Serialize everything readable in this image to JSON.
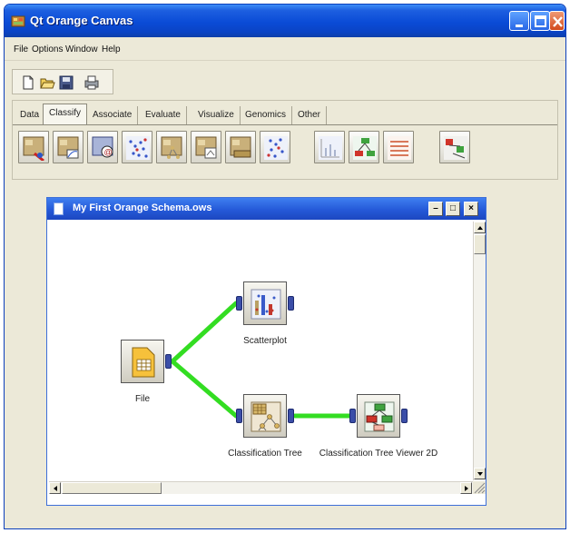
{
  "window": {
    "title": "Qt Orange Canvas"
  },
  "menu": [
    "File",
    "Options",
    "Window",
    "Help"
  ],
  "toolbar": [
    "new-document-icon",
    "open-folder-icon",
    "save-disk-icon",
    "print-icon"
  ],
  "tabs": [
    "Data",
    "Classify",
    "Associate",
    "Evaluate",
    "Visualize",
    "Genomics",
    "Other"
  ],
  "active_tab": "Classify",
  "widgets": [
    "naive-bayes-widget-icon",
    "logistic-regression-widget-icon",
    "majority-widget-icon",
    "knn-widget-icon",
    "classification-tree-widget-icon",
    "c45-widget-icon",
    "interactive-tree-widget-icon",
    "cn2-widget-icon",
    "svm-widget-icon",
    "tree-viewer-widget-icon",
    "rules-viewer-widget-icon",
    "nomogram-widget-icon"
  ],
  "document": {
    "title": "My First Orange Schema.ows",
    "nodes": [
      {
        "id": "file",
        "label": "File"
      },
      {
        "id": "scatterplot",
        "label": "Scatterplot"
      },
      {
        "id": "classification-tree",
        "label": "Classification Tree"
      },
      {
        "id": "tree-viewer",
        "label": "Classification Tree Viewer 2D"
      }
    ],
    "links": [
      {
        "from": "file",
        "to": "scatterplot"
      },
      {
        "from": "file",
        "to": "classification-tree"
      },
      {
        "from": "classification-tree",
        "to": "tree-viewer"
      }
    ],
    "link_color": "#33dd22"
  }
}
